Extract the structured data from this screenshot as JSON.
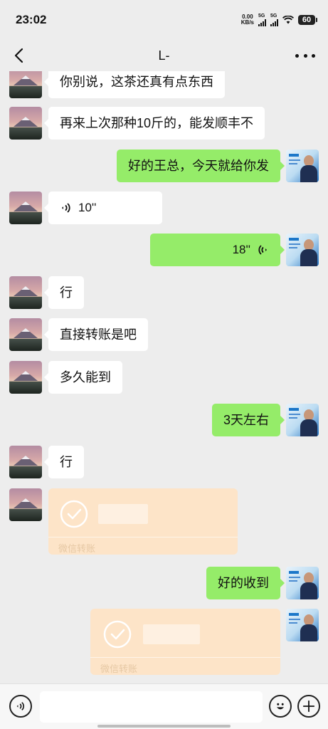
{
  "status_bar": {
    "time": "23:02",
    "net_speed_value": "0.00",
    "net_speed_unit": "KB/s",
    "sim1_label": "5G",
    "sim2_label": "5G",
    "battery": "60"
  },
  "nav": {
    "title": "L-"
  },
  "messages": [
    {
      "side": "in",
      "type": "text",
      "text": "你别说，这茶还真有点东西"
    },
    {
      "side": "in",
      "type": "text",
      "text": "再来上次那种10斤的，能发顺丰不"
    },
    {
      "side": "out",
      "type": "text",
      "text": "好的王总，今天就给你发"
    },
    {
      "side": "in",
      "type": "voice",
      "duration": "10''"
    },
    {
      "side": "out",
      "type": "voice",
      "duration": "18''"
    },
    {
      "side": "in",
      "type": "text",
      "text": "行"
    },
    {
      "side": "in",
      "type": "text",
      "text": "直接转账是吧"
    },
    {
      "side": "in",
      "type": "text",
      "text": "多久能到"
    },
    {
      "side": "out",
      "type": "text",
      "text": "3天左右"
    },
    {
      "side": "in",
      "type": "text",
      "text": "行"
    },
    {
      "side": "in",
      "type": "transfer",
      "caption": "微信转账",
      "status": "received"
    },
    {
      "side": "out",
      "type": "text",
      "text": "好的收到"
    },
    {
      "side": "out",
      "type": "transfer",
      "caption": "微信转账",
      "status": "received"
    }
  ],
  "icons": {
    "back": "chevron-left-icon",
    "more": "more-dots-icon",
    "voice_input": "voice-input-icon",
    "emoji": "emoji-icon",
    "plus": "plus-icon",
    "transfer_done": "check-circle-icon"
  },
  "colors": {
    "background": "#ededed",
    "bubble_out": "#95ec69",
    "bubble_in": "#ffffff",
    "transfer": "#fde4c8"
  }
}
